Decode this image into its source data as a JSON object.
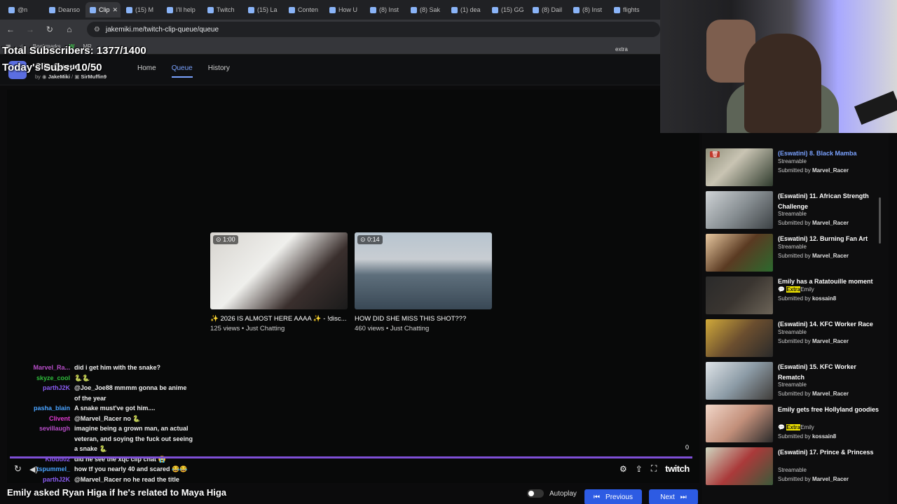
{
  "browser": {
    "tabs": [
      "@n",
      "Deanso",
      "Clip",
      "(15) M",
      "I'll help",
      "Twitch",
      "(15) La",
      "Conten",
      "How U",
      "(8) Inst",
      "(8) Sak",
      "(1) dea",
      "(15) GG",
      "(8) Dail",
      "(8) Inst",
      "flights"
    ],
    "url": "jakemiki.me/twitch-clip-queue/queue",
    "bookmarks_label": "Bookmarks",
    "bookmark_items": [
      "W",
      "MR"
    ],
    "extra_label": "extra"
  },
  "overlay": {
    "total_subscribers": "Total Subscribers: 1377/1400",
    "todays_subs": "Today's Subs: 10/50"
  },
  "app": {
    "title": "Clip Queue",
    "byline_by": "by",
    "author1": "JakeMiki",
    "author2": "SirMuffin9",
    "nav": [
      "Home",
      "Queue",
      "History"
    ]
  },
  "player": {
    "cards": [
      {
        "duration": "1:00",
        "title": "✨ 2026 IS ALMOST HERE AAAA ✨ - !disc...",
        "meta": "125 views • Just Chatting"
      },
      {
        "duration": "0:14",
        "title": "HOW DID SHE MISS THIS SHOT???",
        "meta": "460 views • Just Chatting"
      }
    ],
    "counter": "0",
    "twitch_logo": "twitch",
    "bottom_title": "Emily asked Ryan Higa if he's related to Maya Higa",
    "autoplay_label": "Autoplay",
    "previous_label": "Previous",
    "next_label": "Next"
  },
  "chat": [
    {
      "user": "Marvel_Ra...",
      "color": "#b84ec9",
      "msg": "did i get him with the snake?"
    },
    {
      "user": "skyze_cool",
      "color": "#2fbf3c",
      "msg": "🐍🐍"
    },
    {
      "user": "parthJ2K",
      "color": "#8a5cf0",
      "msg": "@Joe_Joe88 mmmm gonna be anime of the year"
    },
    {
      "user": "pasha_blain",
      "color": "#4aa3ff",
      "msg": "A snake must've got him...."
    },
    {
      "user": "Clivent",
      "color": "#e23bd3",
      "msg": "@Marvel_Racer no 🐍"
    },
    {
      "user": "sevillaugh",
      "color": "#b84ec9",
      "msg": "imagine being a grown man, an actual veteran, and soying the fuck out seeing a snake 🐍"
    },
    {
      "user": "Kloud02",
      "color": "#8a5cf0",
      "msg": "did he see the xqc clip chat 😭"
    },
    {
      "user": "tspummel_",
      "color": "#4aa3ff",
      "msg": "how tf you nearly 40 and scared 😂😂"
    },
    {
      "user": "parthJ2K",
      "color": "#8a5cf0",
      "msg": "@Marvel_Racer no he read the title"
    }
  ],
  "queue": [
    {
      "title": "(Eswatini) 8. Black Mamba",
      "active": true,
      "source": "Streamable",
      "submitter": "Marvel_Racer",
      "extra": false
    },
    {
      "title": "(Eswatini) 11. African Strength Challenge",
      "active": false,
      "source": "Streamable",
      "submitter": "Marvel_Racer",
      "extra": false
    },
    {
      "title": "(Eswatini) 12. Burning Fan Art",
      "active": false,
      "source": "Streamable",
      "submitter": "Marvel_Racer",
      "extra": false
    },
    {
      "title": "Emily has a Ratatouille moment",
      "active": false,
      "source_hl": "Extra",
      "source": "Emily",
      "submitter": "kossain8",
      "extra": true
    },
    {
      "title": "(Eswatini) 14. KFC Worker Race",
      "active": false,
      "source": "Streamable",
      "submitter": "Marvel_Racer",
      "extra": false
    },
    {
      "title": "(Eswatini) 15. KFC Worker Rematch",
      "active": false,
      "source": "Streamable",
      "submitter": "Marvel_Racer",
      "extra": false
    },
    {
      "title": "Emily gets free Hollyland goodies",
      "active": false,
      "source_hl": "Extra",
      "source": "Emily",
      "submitter": "kossain8",
      "extra": true
    },
    {
      "title": "(Eswatini) 17. Prince & Princess",
      "active": false,
      "source": "Streamable",
      "submitter": "Marvel_Racer",
      "extra": false
    }
  ],
  "submitted_by": "Submitted by"
}
